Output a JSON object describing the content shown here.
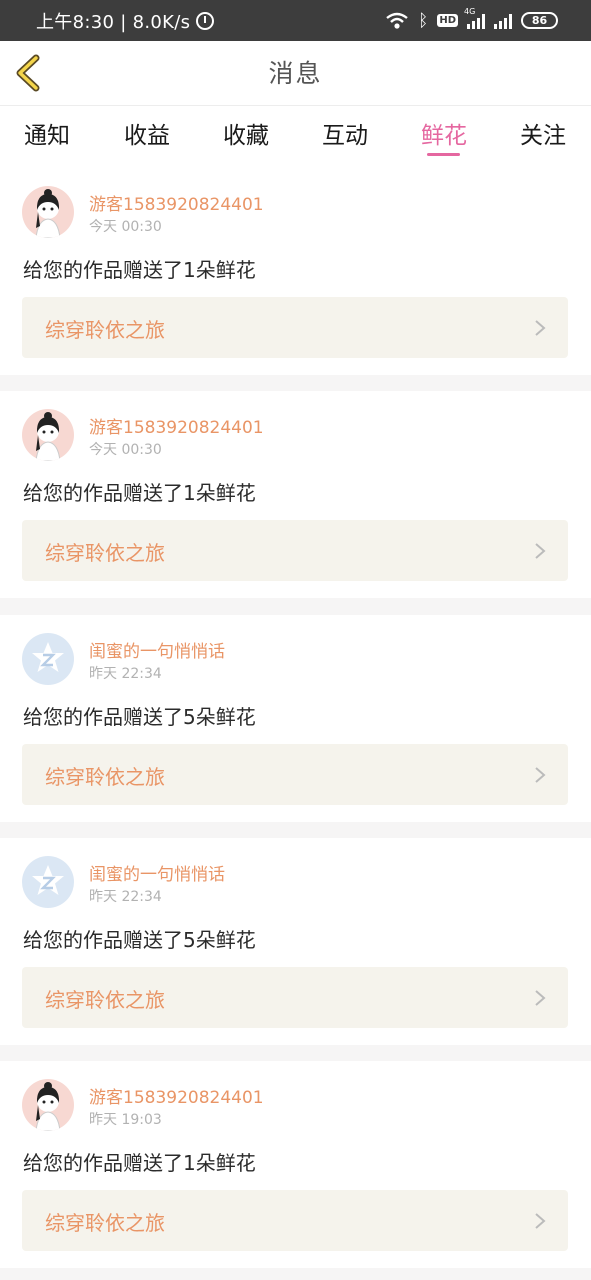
{
  "status_bar": {
    "time_and_speed": "上午8:30 | 8.0K/s",
    "hd": "HD",
    "network": "4G",
    "battery": "86"
  },
  "header": {
    "title": "消息",
    "back_icon": "chevron-left-icon"
  },
  "tabs": [
    {
      "label": "通知"
    },
    {
      "label": "收益"
    },
    {
      "label": "收藏"
    },
    {
      "label": "互动"
    },
    {
      "label": "鲜花",
      "active": true
    },
    {
      "label": "关注"
    }
  ],
  "colors": {
    "accent": "#e567a0",
    "orange": "#e99566",
    "gray_text": "#b2b2b2"
  },
  "messages": [
    {
      "user": "游客1583920824401",
      "time": "今天 00:30",
      "avatar": "girl-avatar",
      "text": "给您的作品赠送了1朵鲜花",
      "work": "综穿聆依之旅"
    },
    {
      "user": "游客1583920824401",
      "time": "今天 00:30",
      "avatar": "girl-avatar",
      "text": "给您的作品赠送了1朵鲜花",
      "work": "综穿聆依之旅"
    },
    {
      "user": "闺蜜的一句悄悄话",
      "time": "昨天 22:34",
      "avatar": "qq-avatar",
      "text": "给您的作品赠送了5朵鲜花",
      "work": "综穿聆依之旅"
    },
    {
      "user": "闺蜜的一句悄悄话",
      "time": "昨天 22:34",
      "avatar": "qq-avatar",
      "text": "给您的作品赠送了5朵鲜花",
      "work": "综穿聆依之旅"
    },
    {
      "user": "游客1583920824401",
      "time": "昨天 19:03",
      "avatar": "girl-avatar",
      "text": "给您的作品赠送了1朵鲜花",
      "work": "综穿聆依之旅"
    }
  ]
}
